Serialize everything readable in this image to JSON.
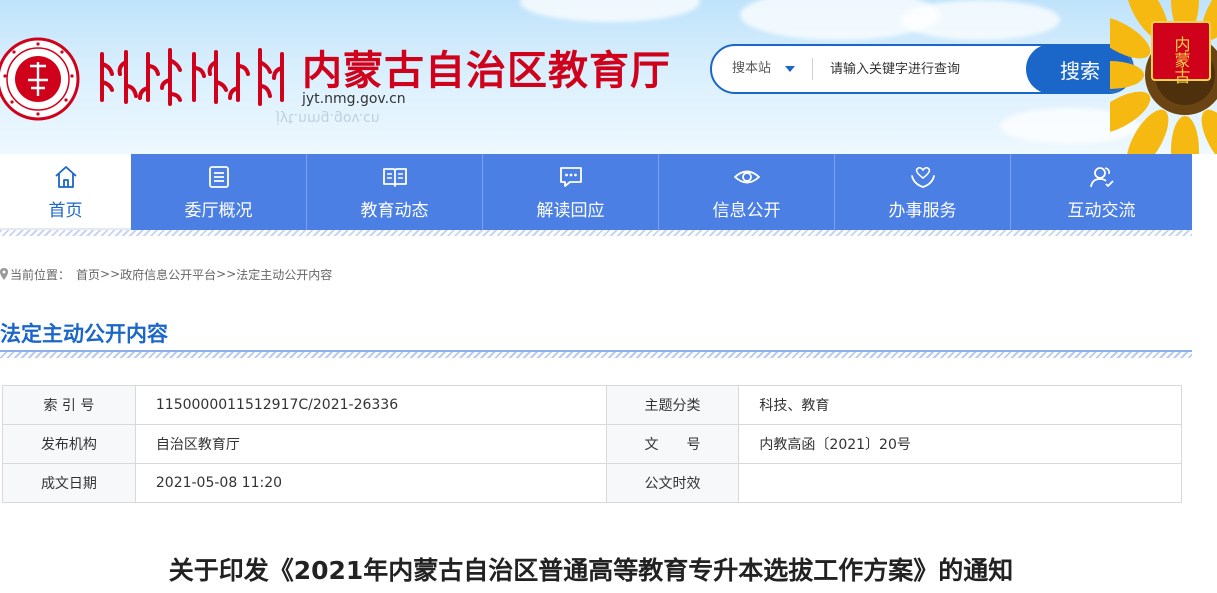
{
  "header": {
    "site_title": "内蒙古自治区教育厅",
    "site_domain": "jyt.nmg.gov.cn",
    "badge_text": "内蒙古",
    "colors": {
      "title_red": "#d0021b",
      "brand_blue": "#1a66c9",
      "nav_blue": "#4b7fe4"
    }
  },
  "search": {
    "scope_label": "搜本站",
    "placeholder": "请输入关键字进行查询",
    "button_label": "搜索"
  },
  "nav": {
    "items": [
      {
        "label": "首页",
        "icon": "home-icon"
      },
      {
        "label": "委厅概况",
        "icon": "list-icon"
      },
      {
        "label": "教育动态",
        "icon": "book-icon"
      },
      {
        "label": "解读回应",
        "icon": "chat-icon"
      },
      {
        "label": "信息公开",
        "icon": "eye-icon"
      },
      {
        "label": "办事服务",
        "icon": "hands-icon"
      },
      {
        "label": "互动交流",
        "icon": "users-icon"
      }
    ]
  },
  "breadcrumb": {
    "prefix": "当前位置：",
    "items": [
      "首页",
      "政府信息公开平台",
      "法定主动公开内容"
    ],
    "separator": ">>"
  },
  "section": {
    "title": "法定主动公开内容"
  },
  "info": {
    "rows": [
      [
        {
          "k": "索 引 号",
          "v": "1150000011512917C/2021-26336"
        },
        {
          "k": "主题分类",
          "v": "科技、教育"
        }
      ],
      [
        {
          "k": "发布机构",
          "v": "自治区教育厅"
        },
        {
          "k": "文　　号",
          "v": "内教高函〔2021〕20号"
        }
      ],
      [
        {
          "k": "成文日期",
          "v": "2021-05-08 11:20"
        },
        {
          "k": "公文时效",
          "v": ""
        }
      ]
    ]
  },
  "article": {
    "title": "关于印发《2021年内蒙古自治区普通高等教育专升本选拔工作方案》的通知"
  }
}
